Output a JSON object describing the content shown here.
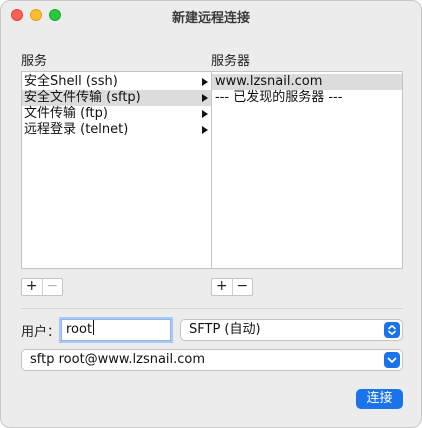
{
  "window": {
    "title": "新建远程连接"
  },
  "services": {
    "label": "服务",
    "items": [
      {
        "label": "安全Shell (ssh)",
        "selected": false
      },
      {
        "label": "安全文件传输 (sftp)",
        "selected": true
      },
      {
        "label": "文件传输 (ftp)",
        "selected": false
      },
      {
        "label": "远程登录 (telnet)",
        "selected": false
      }
    ],
    "add_label": "+",
    "remove_label": "−"
  },
  "servers": {
    "label": "服务器",
    "items": [
      {
        "label": "www.lzsnail.com",
        "selected": true
      },
      {
        "label": "--- 已发现的服务器 ---",
        "selected": false
      }
    ],
    "add_label": "+",
    "remove_label": "−"
  },
  "user": {
    "label": "用户：",
    "value": "root"
  },
  "protocol_select": {
    "value": "SFTP (自动)",
    "icon": "up-down-chevron-icon"
  },
  "command_select": {
    "value": "sftp root@www.lzsnail.com",
    "icon": "chevron-down-icon"
  },
  "connect_button": {
    "label": "连接"
  },
  "colors": {
    "accent": "#1a73e8",
    "close": "#fe5f57",
    "minimize": "#febc2e",
    "maximize": "#28c840"
  }
}
